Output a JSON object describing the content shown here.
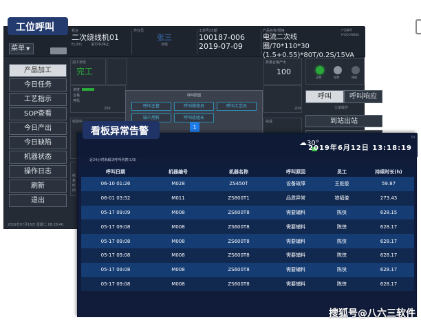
{
  "banners": {
    "station": "工位呼叫",
    "board": "看板异常告警"
  },
  "station": {
    "menu_label": "菜单",
    "header": [
      {
        "label": "机台",
        "value": "二次绕线机01",
        "sub": "EL001",
        "sub2": "进行中/停止"
      },
      {
        "label": "作业员",
        "value": "张三",
        "sub": "",
        "sub2": "点检"
      },
      {
        "label": "工单号/日期",
        "value": "100187-006",
        "value2": "2019-07-09"
      },
      {
        "label": "产品名称/规格",
        "value": "电流二次线圈/70*110*30",
        "value2": "(1.5+0.55)*80T/0.2S/15VA"
      },
      {
        "label": "产品编号",
        "value": "HY20190806"
      }
    ],
    "side_menu": [
      "产品加工",
      "今日任务",
      "工艺指示",
      "SOP查看",
      "今日产出",
      "今日缺陷",
      "机器状态",
      "操作日志",
      "刷新",
      "退出"
    ],
    "panels": {
      "process_label": "加工状态",
      "process_value": "完工",
      "qty_label": "数量合格产出",
      "qty_value": "100",
      "progress_labels": [
        "进度",
        "合格",
        "停机"
      ],
      "time_left": "20d",
      "time_right": "20d",
      "lower_left": "检验中",
      "lower_right": "完成",
      "mid_label": "结束时间"
    },
    "lights": [
      "正常",
      "异常",
      "停机"
    ],
    "tabs": {
      "call": "呼叫",
      "respond": "呼叫响应"
    },
    "tab_sub": "工单操作",
    "actions": [
      "到站出站",
      ""
    ],
    "popup": {
      "title": "呼叫原因",
      "buttons": [
        "呼叫主管",
        "呼叫维修员",
        "呼叫工艺员",
        "缺少用料",
        "呼叫班组长"
      ]
    },
    "page_number": "1",
    "status_bar": "2019年07月16日 星期二 08:28:40"
  },
  "board": {
    "version": "54",
    "weather_temp": "30°",
    "weather_aqi": "良",
    "clock": "2019年6月12日 13:18:19",
    "subtitle": "近24小时未解决呼叫列表(1/3)",
    "columns": [
      "呼叫日期",
      "机器编号",
      "机器名称",
      "呼叫原因",
      "员工",
      "持续时长(h)"
    ],
    "rows": [
      [
        "06-10 01:26",
        "M028",
        "ZS450T",
        "设备故障",
        "王蛇俊",
        "59.87"
      ],
      [
        "06-01 03:52",
        "M011",
        "ZS800T1",
        "品质异常",
        "铁福俊",
        "273.43"
      ],
      [
        "05-17 09:09",
        "M008",
        "ZS600T8",
        "需要辅料",
        "陈侠",
        "628.15"
      ],
      [
        "05-17 09:08",
        "M008",
        "ZS600T8",
        "需要辅料",
        "陈侠",
        "628.17"
      ],
      [
        "05-17 09:08",
        "M008",
        "ZS600T8",
        "需要辅料",
        "陈侠",
        "628.17"
      ],
      [
        "05-17 09:08",
        "M008",
        "ZS600T8",
        "需要辅料",
        "陈侠",
        "628.17"
      ],
      [
        "05-17 09:08",
        "M008",
        "ZS600T8",
        "需要辅料",
        "陈侠",
        "628.17"
      ],
      [
        "05-17 09:08",
        "M008",
        "ZS600T8",
        "需要辅料",
        "陈侠",
        "628.17"
      ]
    ]
  },
  "watermark": "搜狐号@八六三软件",
  "colors": {
    "banner": "#243b70",
    "popup_border": "#2f8fb4",
    "page_active": "#1e7bea",
    "ok_green": "#2aa83a",
    "row_odd": "#153c73",
    "row_even": "#11284f"
  }
}
